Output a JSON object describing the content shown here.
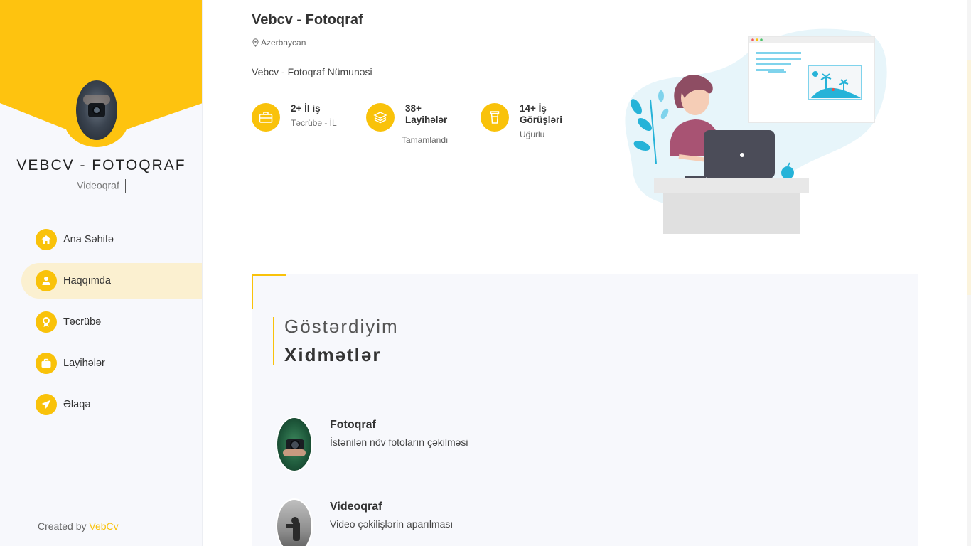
{
  "sidebar": {
    "title": "VEBCV - FOTOQRAF",
    "subtitle": "Videoqraf",
    "nav": [
      {
        "label": "Ana Səhifə",
        "icon": "home-icon",
        "active": false
      },
      {
        "label": "Haqqımda",
        "icon": "user-icon",
        "active": true
      },
      {
        "label": "Təcrübə",
        "icon": "award-icon",
        "active": false
      },
      {
        "label": "Layihələr",
        "icon": "briefcase-icon",
        "active": false
      },
      {
        "label": "Əlaqə",
        "icon": "send-icon",
        "active": false
      }
    ],
    "footer_prefix": "Created by",
    "footer_brand": "VebCv"
  },
  "hero": {
    "title": "Vebcv - Fotoqraf",
    "location": "Azerbaycan",
    "description": "Vebcv - Fotoqraf Nümunəsi",
    "stats": [
      {
        "number": "2+ İl iş",
        "caption": "Təcrübə - İL",
        "icon": "briefcase-icon"
      },
      {
        "number": "38+ Layihələr",
        "caption": "Tamamlandı",
        "icon": "layers-icon"
      },
      {
        "number": "14+ İş Görüşləri",
        "caption": "Uğurlu",
        "icon": "cup-icon"
      }
    ]
  },
  "services": {
    "pretitle": "Göstərdiyim",
    "title": "Xidmətlər",
    "items": [
      {
        "name": "Fotoqraf",
        "description": "İstənilən növ fotoların çəkilməsi"
      },
      {
        "name": "Videoqraf",
        "description": "Video çəkilişlərin aparılması"
      }
    ]
  },
  "colors": {
    "accent": "#f9c20a",
    "active_bg": "#fbf0d0",
    "sidebar_bg": "#f7f8fc"
  }
}
